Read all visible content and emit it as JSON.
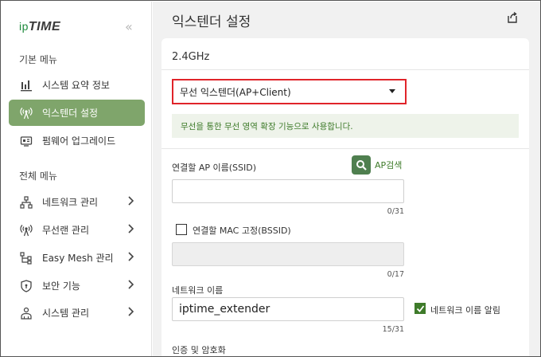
{
  "logo": {
    "ip": "ip",
    "time": "TIME"
  },
  "sidebar": {
    "collapse_glyph": "«",
    "basic_section": "기본 메뉴",
    "basic_items": [
      {
        "label": "시스템 요약 정보",
        "icon": "bar-chart-icon"
      },
      {
        "label": "익스텐더 설정",
        "icon": "wireless-icon",
        "active": true
      },
      {
        "label": "펌웨어 업그레이드",
        "icon": "firmware-icon"
      }
    ],
    "all_section": "전체 메뉴",
    "all_items": [
      {
        "label": "네트워크 관리",
        "icon": "network-icon"
      },
      {
        "label": "무선랜 관리",
        "icon": "wireless-icon"
      },
      {
        "label": "Easy Mesh 관리",
        "icon": "mesh-icon"
      },
      {
        "label": "보안 기능",
        "icon": "shield-icon"
      },
      {
        "label": "시스템 관리",
        "icon": "system-icon"
      }
    ]
  },
  "header": {
    "title": "익스텐더 설정"
  },
  "card": {
    "band": "2.4GHz",
    "mode_select": {
      "value": "무선 익스텐더(AP+Client)"
    },
    "info": "무선을 통한 무선 영역 확장 기능으로 사용합니다.",
    "ssid": {
      "label": "연결할 AP 이름(SSID)",
      "value": "",
      "counter": "0/31",
      "search_label": "AP검색"
    },
    "mac_lock": {
      "label": "연결할 MAC 고정(BSSID)",
      "checked": false,
      "value": "",
      "counter": "0/17"
    },
    "network_name": {
      "label": "네트워크 이름",
      "value": "iptime_extender",
      "counter": "15/31",
      "broadcast_label": "네트워크 이름 알림",
      "broadcast_checked": true
    },
    "auth": {
      "label": "인증 및 암호화"
    }
  },
  "colors": {
    "accent": "#7fa56b",
    "highlight": "#e0242a",
    "green_text": "#3e7b2a"
  }
}
